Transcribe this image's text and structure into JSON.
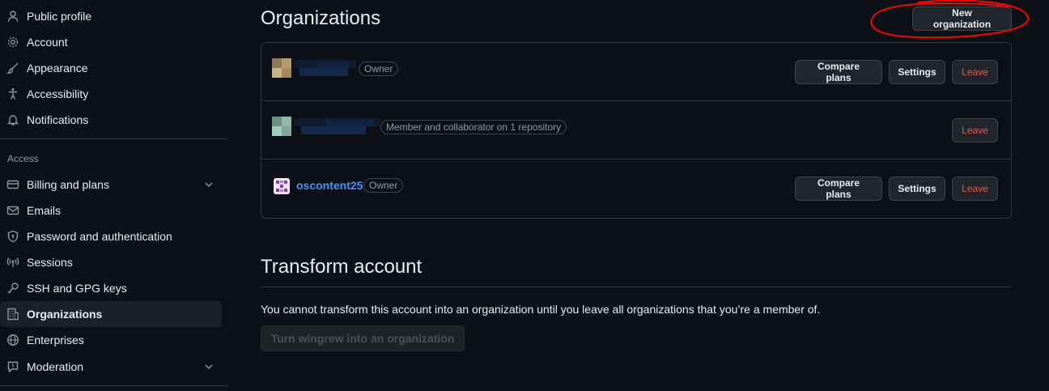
{
  "sidebar": {
    "items_top": [
      {
        "label": "Public profile",
        "icon": "person-icon"
      },
      {
        "label": "Account",
        "icon": "gear-icon"
      },
      {
        "label": "Appearance",
        "icon": "paintbrush-icon"
      },
      {
        "label": "Accessibility",
        "icon": "accessibility-icon"
      },
      {
        "label": "Notifications",
        "icon": "bell-icon"
      }
    ],
    "access_label": "Access",
    "items_access": [
      {
        "label": "Billing and plans",
        "icon": "credit-card-icon",
        "expandable": true
      },
      {
        "label": "Emails",
        "icon": "mail-icon"
      },
      {
        "label": "Password and authentication",
        "icon": "shield-lock-icon"
      },
      {
        "label": "Sessions",
        "icon": "broadcast-icon"
      },
      {
        "label": "SSH and GPG keys",
        "icon": "key-icon"
      },
      {
        "label": "Organizations",
        "icon": "organization-icon",
        "active": true
      },
      {
        "label": "Enterprises",
        "icon": "globe-icon"
      },
      {
        "label": "Moderation",
        "icon": "report-icon",
        "expandable": true
      }
    ]
  },
  "organizations": {
    "title": "Organizations",
    "new_button": "New organization",
    "rows": [
      {
        "name": "",
        "badge": "Owner",
        "buttons": [
          "Compare plans",
          "Settings",
          "Leave"
        ]
      },
      {
        "name": "",
        "badge": "Member and collaborator on 1 repository",
        "buttons": [
          "Leave"
        ]
      },
      {
        "name": "oscontent25",
        "badge": "Owner",
        "buttons": [
          "Compare plans",
          "Settings",
          "Leave"
        ]
      }
    ]
  },
  "transform": {
    "title": "Transform account",
    "description": "You cannot transform this account into an organization until you leave all organizations that you’re a member of.",
    "button": "Turn wingrew into an organization"
  },
  "colors": {
    "background": "#0d1117",
    "link": "#4493f8",
    "danger": "#f85149",
    "annotation": "#ff0000"
  }
}
